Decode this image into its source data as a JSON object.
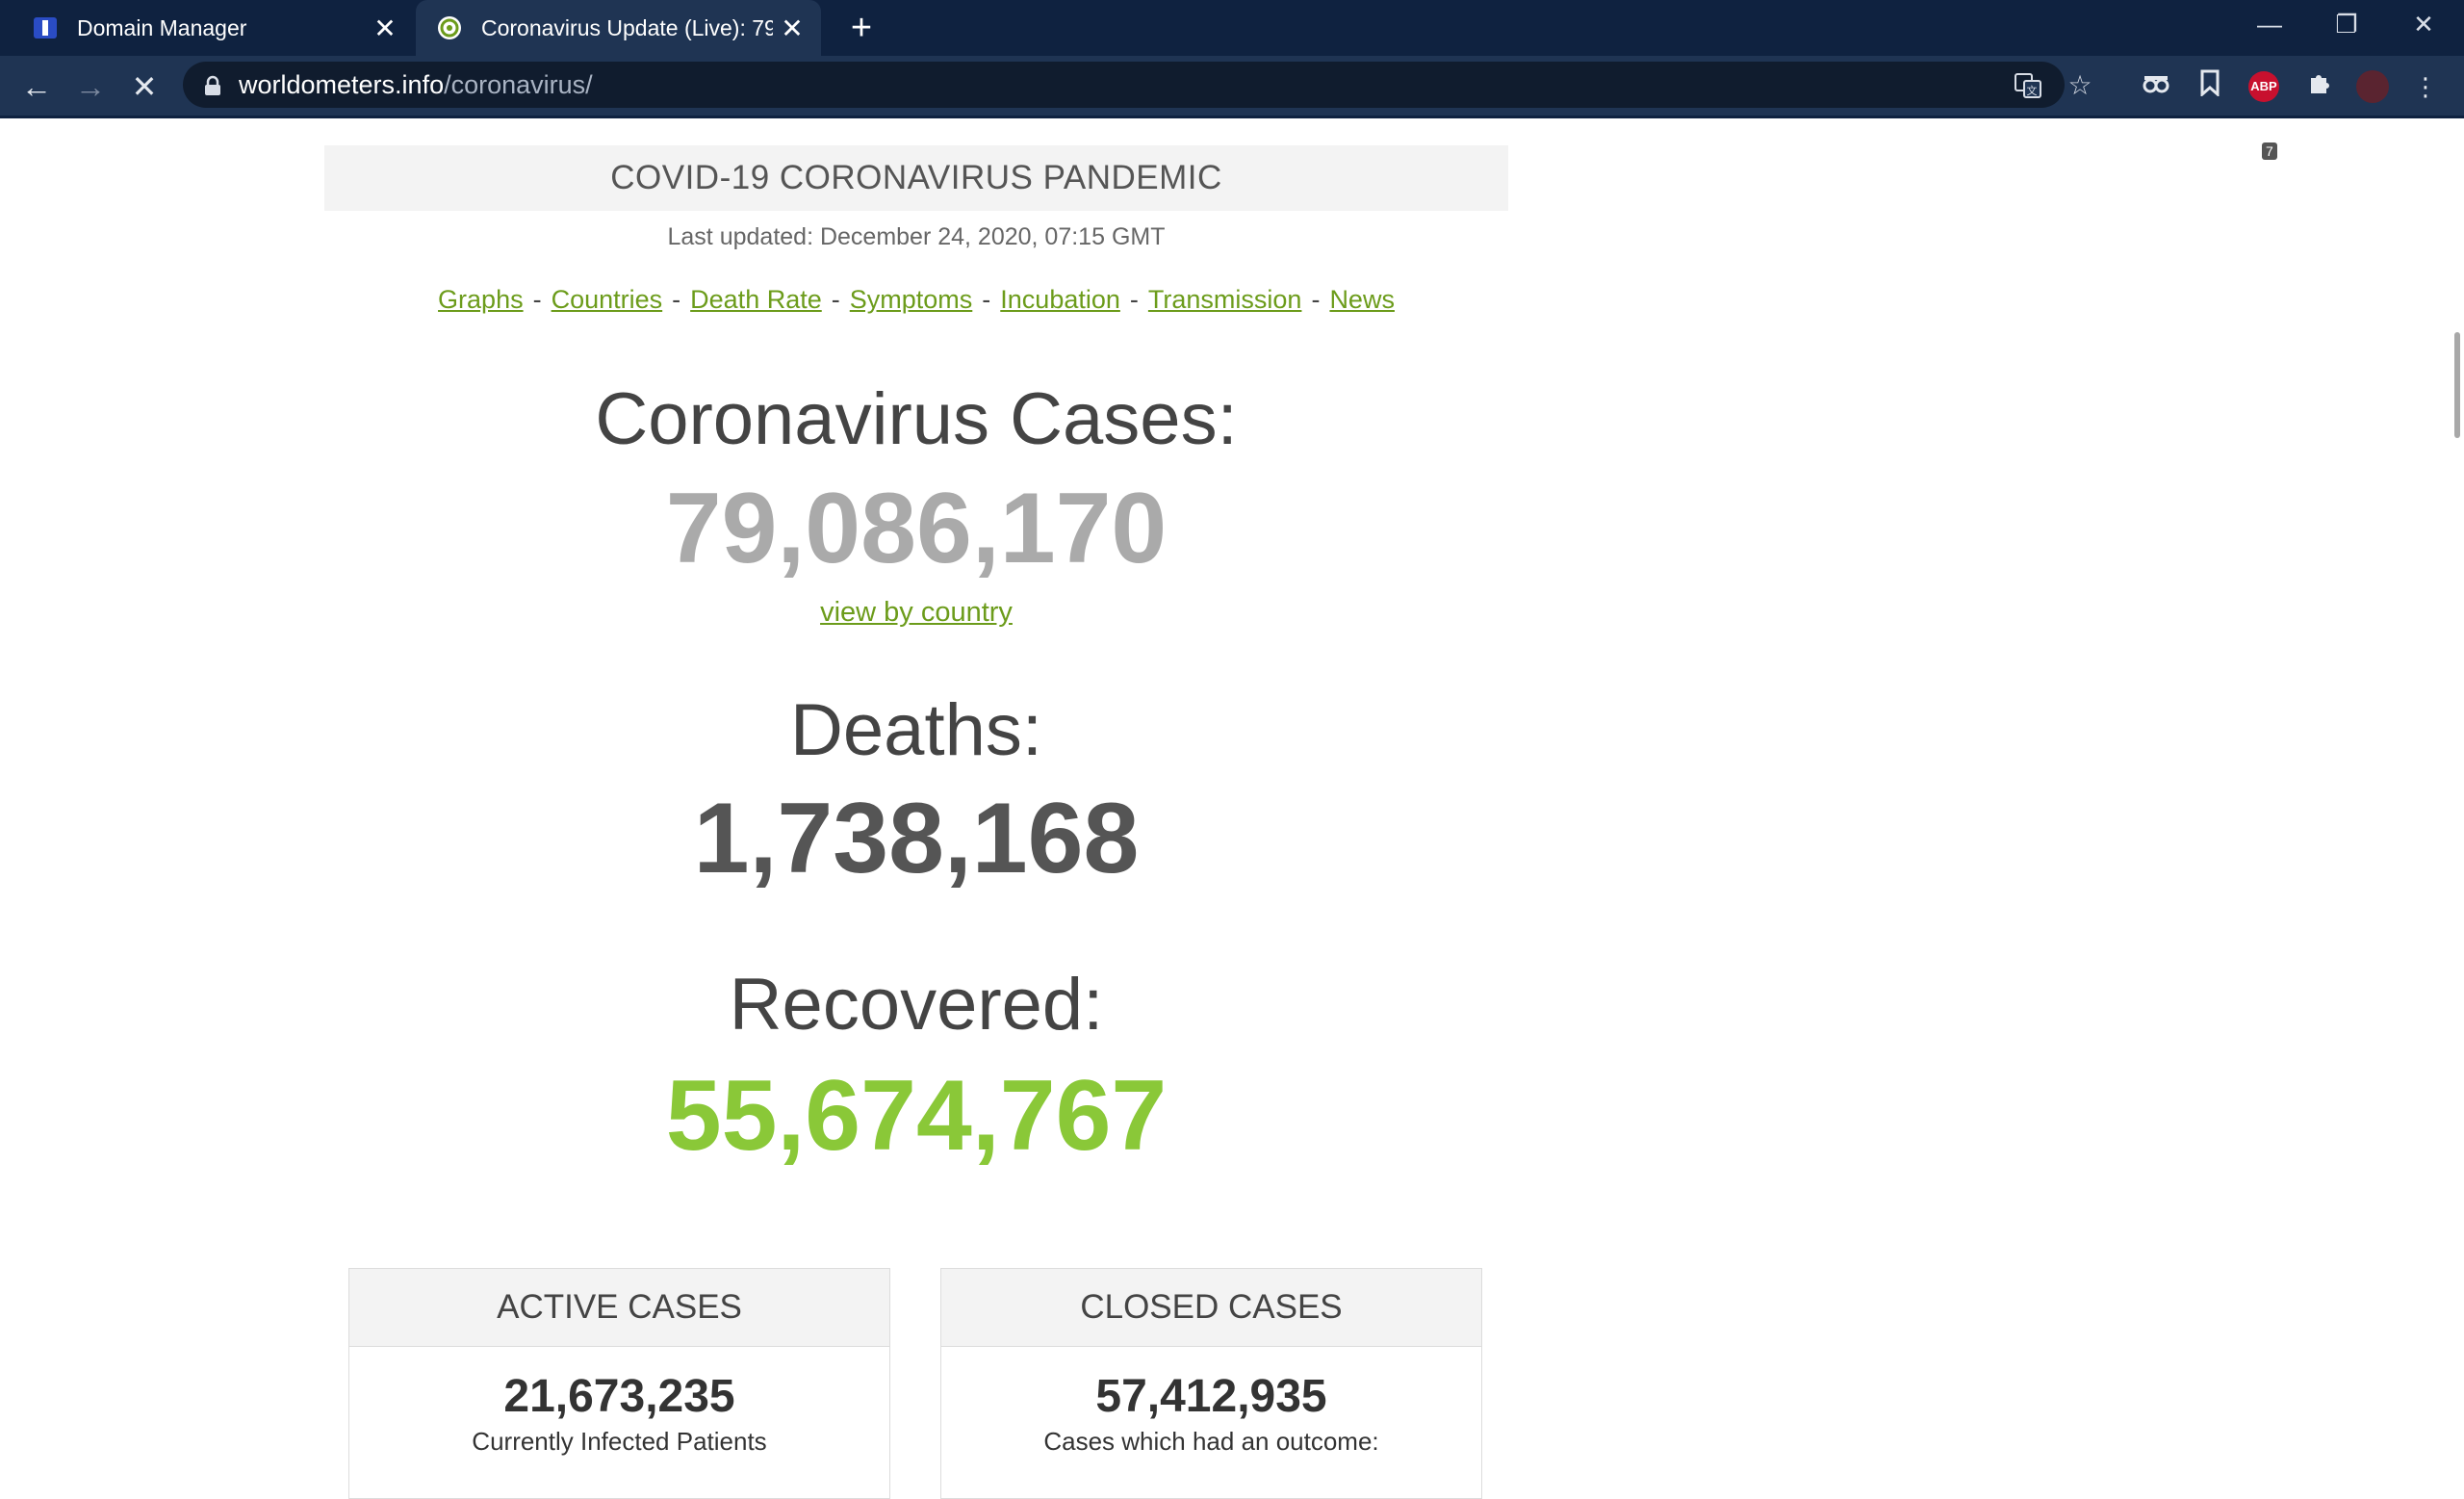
{
  "browser": {
    "tabs": [
      {
        "title": "Domain Manager",
        "favicon": "domain-manager-icon"
      },
      {
        "title": "Coronavirus Update (Live): 79,",
        "favicon": "worldometers-icon",
        "active": true
      }
    ],
    "url_host": "worldometers.info",
    "url_path": "/coronavirus/",
    "abp_badge": "7"
  },
  "page": {
    "header": "COVID-19 CORONAVIRUS PANDEMIC",
    "last_updated": "Last updated: December 24, 2020, 07:15 GMT",
    "nav_links": [
      "Graphs",
      "Countries",
      "Death Rate",
      "Symptoms",
      "Incubation",
      "Transmission",
      "News"
    ],
    "cases_label": "Coronavirus Cases:",
    "cases_value": "79,086,170",
    "view_by_country": "view by country",
    "deaths_label": "Deaths:",
    "deaths_value": "1,738,168",
    "recovered_label": "Recovered:",
    "recovered_value": "55,674,767",
    "active": {
      "title": "ACTIVE CASES",
      "value": "21,673,235",
      "subtitle": "Currently Infected Patients"
    },
    "closed": {
      "title": "CLOSED CASES",
      "value": "57,412,935",
      "subtitle": "Cases which had an outcome:"
    }
  },
  "colors": {
    "link_green": "#6c9c1b",
    "recovered_green": "#8ac838",
    "cases_gray": "#aaaaaa",
    "deaths_gray": "#555555"
  }
}
